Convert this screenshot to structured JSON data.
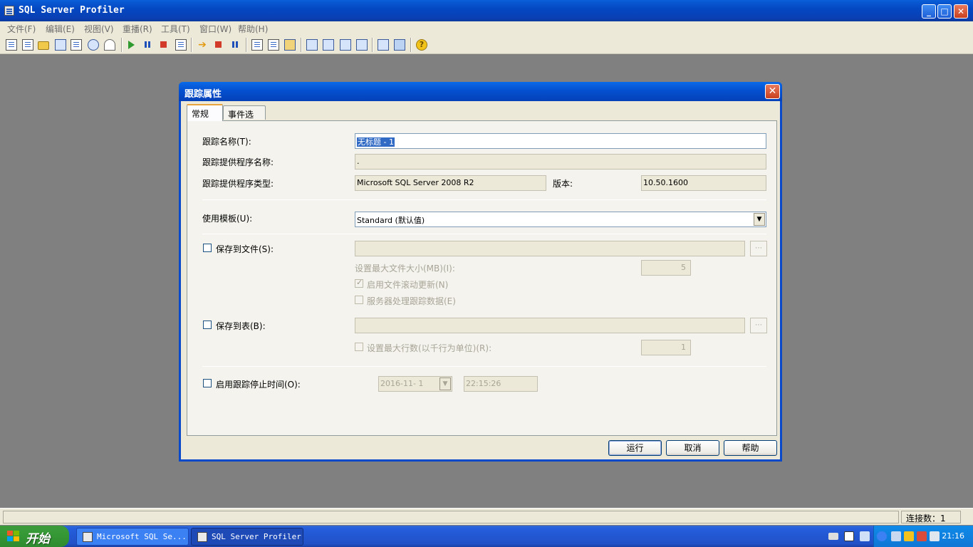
{
  "app": {
    "title": "SQL Server Profiler",
    "window_buttons": {
      "minimize": "_",
      "maximize": "□",
      "close": "✕"
    }
  },
  "menu": [
    "文件(F)",
    "编辑(E)",
    "视图(V)",
    "重播(R)",
    "工具(T)",
    "窗口(W)",
    "帮助(H)"
  ],
  "toolbar": {
    "icons": [
      "new-trace-icon",
      "new-template-icon",
      "open-icon",
      "save-icon",
      "properties-icon",
      "find-icon",
      "clear-icon",
      "run-icon",
      "pause-icon",
      "stop-icon",
      "step-icon",
      "replay-run-icon",
      "replay-stop-icon",
      "replay-pause-icon",
      "event-icon",
      "comment-icon",
      "filter-icon",
      "cascade-icon",
      "tile-horizontal-icon",
      "tile-vertical-icon",
      "arrange-icon",
      "activity-icon",
      "perfmon-icon",
      "help-icon"
    ],
    "help_glyph": "?"
  },
  "status": {
    "connections": "连接数：1"
  },
  "dialog": {
    "title": "跟踪属性",
    "close_glyph": "✕",
    "tabs": [
      "常规",
      "事件选择"
    ],
    "trace_name_label": "跟踪名称(T):",
    "trace_name_value": "无标题 - 1",
    "provider_name_label": "跟踪提供程序名称:",
    "provider_name_value": ".",
    "provider_type_label": "跟踪提供程序类型:",
    "provider_type_value": "Microsoft SQL Server 2008 R2",
    "version_label": "版本:",
    "version_value": "10.50.1600",
    "template_label": "使用模板(U):",
    "template_value": "Standard (默认值)",
    "save_to_file_label": "保存到文件(S):",
    "max_file_size_label": "设置最大文件大小(MB)(I):",
    "max_file_size_value": "5",
    "file_rollover_label": "启用文件滚动更新(N)",
    "server_processes_label": "服务器处理跟踪数据(E)",
    "save_to_table_label": "保存到表(B):",
    "max_rows_label": "设置最大行数(以千行为单位)(R):",
    "max_rows_value": "1",
    "stop_time_label": "启用跟踪停止时间(O):",
    "stop_date_value": "2016-11- 1",
    "stop_time_value": "22:15:26",
    "run_button": "运行",
    "cancel_button": "取消",
    "help_button": "帮助",
    "browse_glyph": "⋯",
    "dropdown_glyph": "▼"
  },
  "taskbar": {
    "start_label": "开始",
    "tasks": [
      {
        "label": "Microsoft SQL Se...",
        "active": false
      },
      {
        "label": "SQL Server Profiler",
        "active": true
      }
    ],
    "clock": "21:16"
  },
  "colors": {
    "title_blue": "#0348c2",
    "start_green": "#359935",
    "face": "#ece9d8"
  }
}
